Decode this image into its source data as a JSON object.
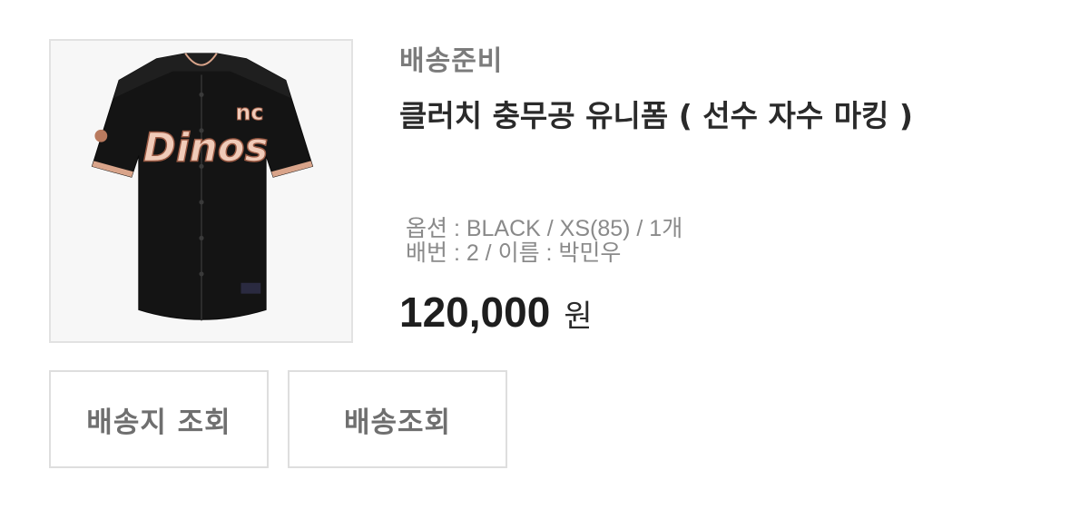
{
  "order": {
    "status": "배송준비",
    "product_name": "클러치 충무공 유니폼 ( 선수 자수 마킹 )",
    "option_line": "옵션 : BLACK / XS(85) / 1개",
    "marking_line": "배번 : 2 / 이름 : 박민우",
    "price_amount": "120,000",
    "price_unit": "원",
    "image": {
      "jersey_wordmark": "Dinos",
      "jersey_logo": "nc",
      "colors": {
        "jersey": "#141414",
        "trim": "#d9a48a",
        "lettering": "#f0cbb9"
      }
    }
  },
  "actions": {
    "address_lookup_label": "배송지 조회",
    "tracking_label": "배송조회"
  }
}
